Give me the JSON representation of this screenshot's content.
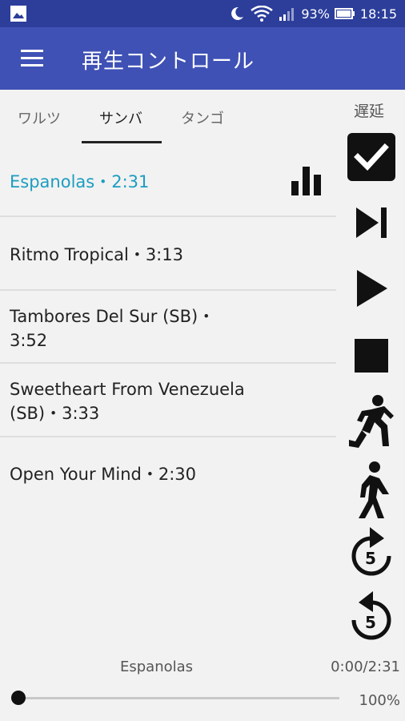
{
  "status_bar": {
    "battery": "93%",
    "time": "18:15"
  },
  "app_bar": {
    "title": "再生コントロール"
  },
  "tabs": [
    {
      "label": "ワルツ"
    },
    {
      "label": "サンバ"
    },
    {
      "label": "タンゴ"
    }
  ],
  "active_tab": "サンバ",
  "tracks": [
    {
      "label": "Espanolas・2:31",
      "playing": true
    },
    {
      "label": "Ritmo Tropical・3:13"
    },
    {
      "label": "Tambores Del Sur (SB)・3:52"
    },
    {
      "label": "Sweetheart From Venezuela (SB)・3:33"
    },
    {
      "label": "Open Your Mind・2:30"
    }
  ],
  "side_panel": {
    "label": "遅延",
    "delay_checked": true,
    "icons": [
      "checkbox-icon",
      "skip-next-icon",
      "play-icon",
      "stop-icon",
      "run-icon",
      "walk-icon",
      "forward-5-icon",
      "replay-5-icon"
    ]
  },
  "player": {
    "now_playing": "Espanolas",
    "time": "0:00/2:31",
    "speed": "100%",
    "progress": 0.0
  },
  "colors": {
    "status_bar": "#2c3e9a",
    "app_bar": "#3f51b5",
    "accent": "#1c9dc0"
  }
}
